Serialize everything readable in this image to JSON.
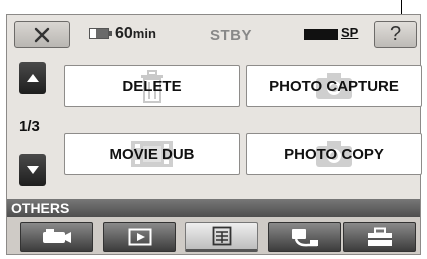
{
  "status_bar": {
    "close_icon": "close-icon",
    "battery_icon": "battery-icon",
    "battery_value": "60",
    "battery_unit": "min",
    "mode": "STBY",
    "record_indicator_icon": "record-bar-icon",
    "quality": "SP",
    "help_label": "?"
  },
  "menu": {
    "page_up_icon": "arrow-up-icon",
    "page_down_icon": "arrow-down-icon",
    "page_indicator": "1/3",
    "items": [
      {
        "label": "DELETE",
        "icon": "trash-icon"
      },
      {
        "label": "PHOTO CAPTURE",
        "icon": "camera-icon"
      },
      {
        "label": "MOVIE DUB",
        "icon": "film-icon"
      },
      {
        "label": "PHOTO COPY",
        "icon": "camera-icon"
      }
    ]
  },
  "section": {
    "label": "OTHERS"
  },
  "tabs": [
    {
      "icon": "camera-mode-icon",
      "active": false
    },
    {
      "icon": "playback-icon",
      "active": false
    },
    {
      "icon": "edit-menu-icon",
      "active": true
    },
    {
      "icon": "print-icon",
      "active": false
    },
    {
      "icon": "toolbox-icon",
      "active": false
    }
  ],
  "colors": {
    "panel_background": "#e7e4e0",
    "section_bar": "#5e5e5e",
    "tab_dark": "#3c3c3c",
    "tab_active": "#efefef"
  }
}
